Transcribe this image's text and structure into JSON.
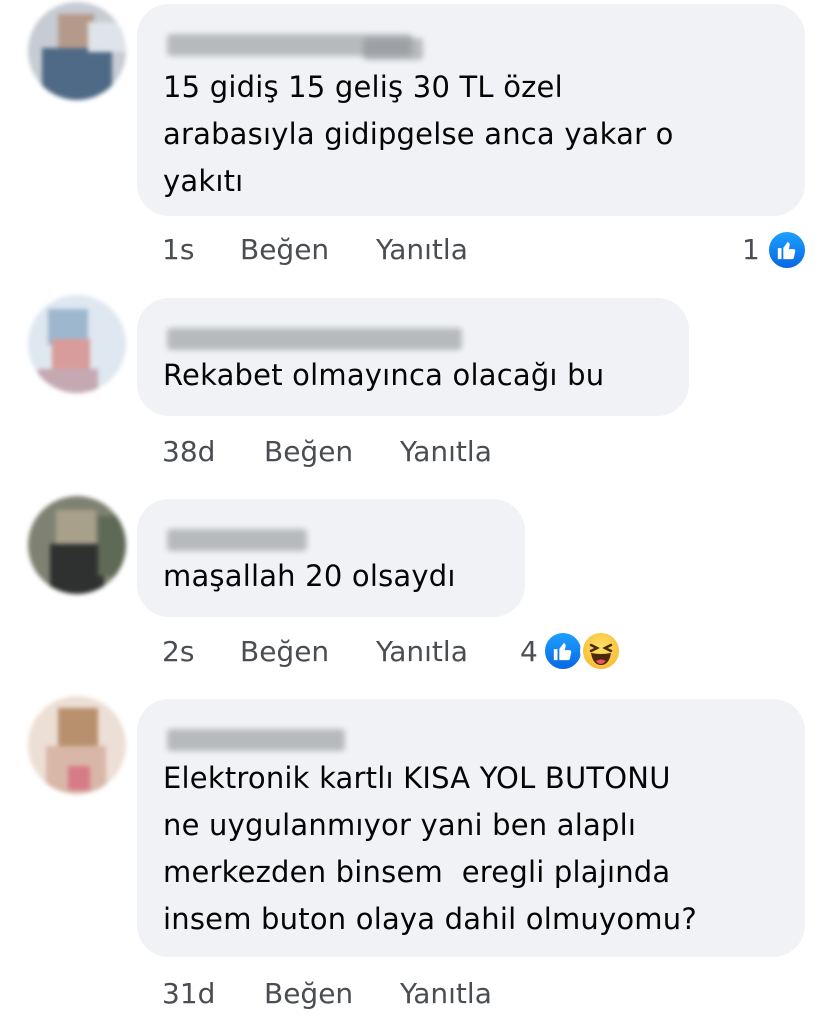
{
  "comments": [
    {
      "text": "15 gidiş 15 geliş 30 TL özel\narabasıyla gidipgelse anca yakar o\nyakıtı",
      "time": "1s",
      "like_label": "Beğen",
      "reply_label": "Yanıtla",
      "reaction_count": "1",
      "reactions": [
        "like-icon"
      ]
    },
    {
      "text": "Rekabet olmayınca olacağı bu",
      "time": "38d",
      "like_label": "Beğen",
      "reply_label": "Yanıtla"
    },
    {
      "text": "maşallah 20 olsaydı",
      "time": "2s",
      "like_label": "Beğen",
      "reply_label": "Yanıtla",
      "reaction_count": "4",
      "reactions": [
        "like-icon",
        "haha-icon"
      ]
    },
    {
      "text": "Elektronik kartlı KISA YOL BUTONU\nne uygulanmıyor yani ben alaplı\nmerkezden binsem  eregli plajında\ninsem buton olaya dahil olmuyomu?",
      "time": "31d",
      "like_label": "Beğen",
      "reply_label": "Yanıtla"
    }
  ],
  "colors": {
    "bubble": "#f0f2f5",
    "text": "#050505",
    "meta": "#4a4d52",
    "like_blue": "#1877f2",
    "haha_yellow": "#f7b125"
  }
}
